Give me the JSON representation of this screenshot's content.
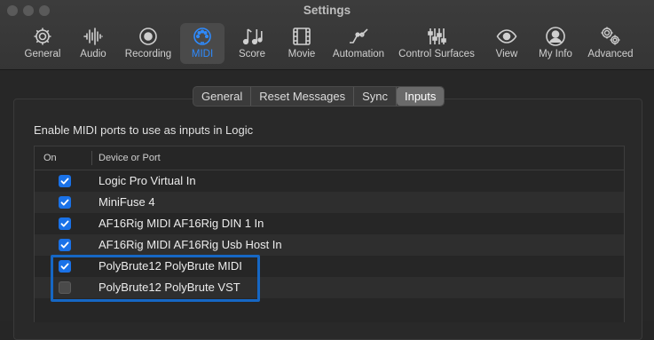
{
  "window": {
    "title": "Settings"
  },
  "toolbar": {
    "items": [
      {
        "label": "General",
        "icon": "gear-icon"
      },
      {
        "label": "Audio",
        "icon": "waveform-icon"
      },
      {
        "label": "Recording",
        "icon": "record-icon"
      },
      {
        "label": "MIDI",
        "icon": "midi-port-icon",
        "active": true
      },
      {
        "label": "Score",
        "icon": "music-notes-icon"
      },
      {
        "label": "Movie",
        "icon": "film-icon"
      },
      {
        "label": "Automation",
        "icon": "automation-curve-icon"
      },
      {
        "label": "Control Surfaces",
        "icon": "faders-icon"
      },
      {
        "label": "View",
        "icon": "eye-icon"
      },
      {
        "label": "My Info",
        "icon": "person-icon"
      },
      {
        "label": "Advanced",
        "icon": "gears-icon"
      }
    ]
  },
  "tabs": [
    "General",
    "Reset Messages",
    "Sync",
    "Inputs"
  ],
  "active_tab": "Inputs",
  "inputs": {
    "instruction": "Enable MIDI ports to use as inputs in Logic",
    "columns": {
      "on": "On",
      "device": "Device or Port"
    },
    "rows": [
      {
        "name": "Logic Pro Virtual In",
        "enabled": true
      },
      {
        "name": "MiniFuse 4",
        "enabled": true
      },
      {
        "name": "AF16Rig MIDI AF16Rig DIN 1 In",
        "enabled": true
      },
      {
        "name": "AF16Rig MIDI AF16Rig Usb Host In",
        "enabled": true
      },
      {
        "name": "PolyBrute12 PolyBrute MIDI",
        "enabled": true
      },
      {
        "name": "PolyBrute12 PolyBrute VST",
        "enabled": false
      }
    ]
  },
  "colors": {
    "accent": "#2e8bff",
    "checkbox": "#1a72e8",
    "highlight_box": "#1667c4"
  }
}
